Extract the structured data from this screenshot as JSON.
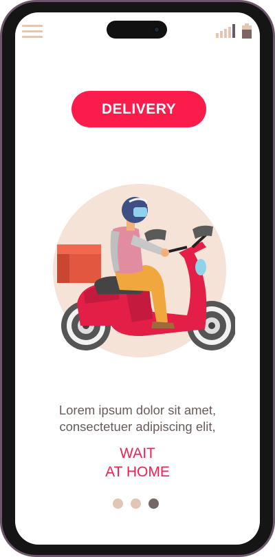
{
  "header": {
    "menu_icon": "hamburger-menu-icon",
    "signal_icon": "signal-strength-icon",
    "battery_icon": "battery-icon"
  },
  "hero": {
    "button_label": "DELIVERY",
    "illustration": "scooter-delivery-rider"
  },
  "content": {
    "body_line1": "Lorem ipsum dolor sit amet,",
    "body_line2": "consectetuer adipiscing elit,",
    "tagline_line1": "WAIT",
    "tagline_line2": "AT HOME"
  },
  "pagination": {
    "count": 3,
    "active_index": 2
  },
  "colors": {
    "accent": "#fb1c4b",
    "tagline": "#f61e4d",
    "body_text": "#6b5b5b",
    "frame": "#6c5669",
    "dot_inactive": "#dfc6b5",
    "dot_active": "#746867",
    "circle_bg": "#f6e3d8"
  }
}
